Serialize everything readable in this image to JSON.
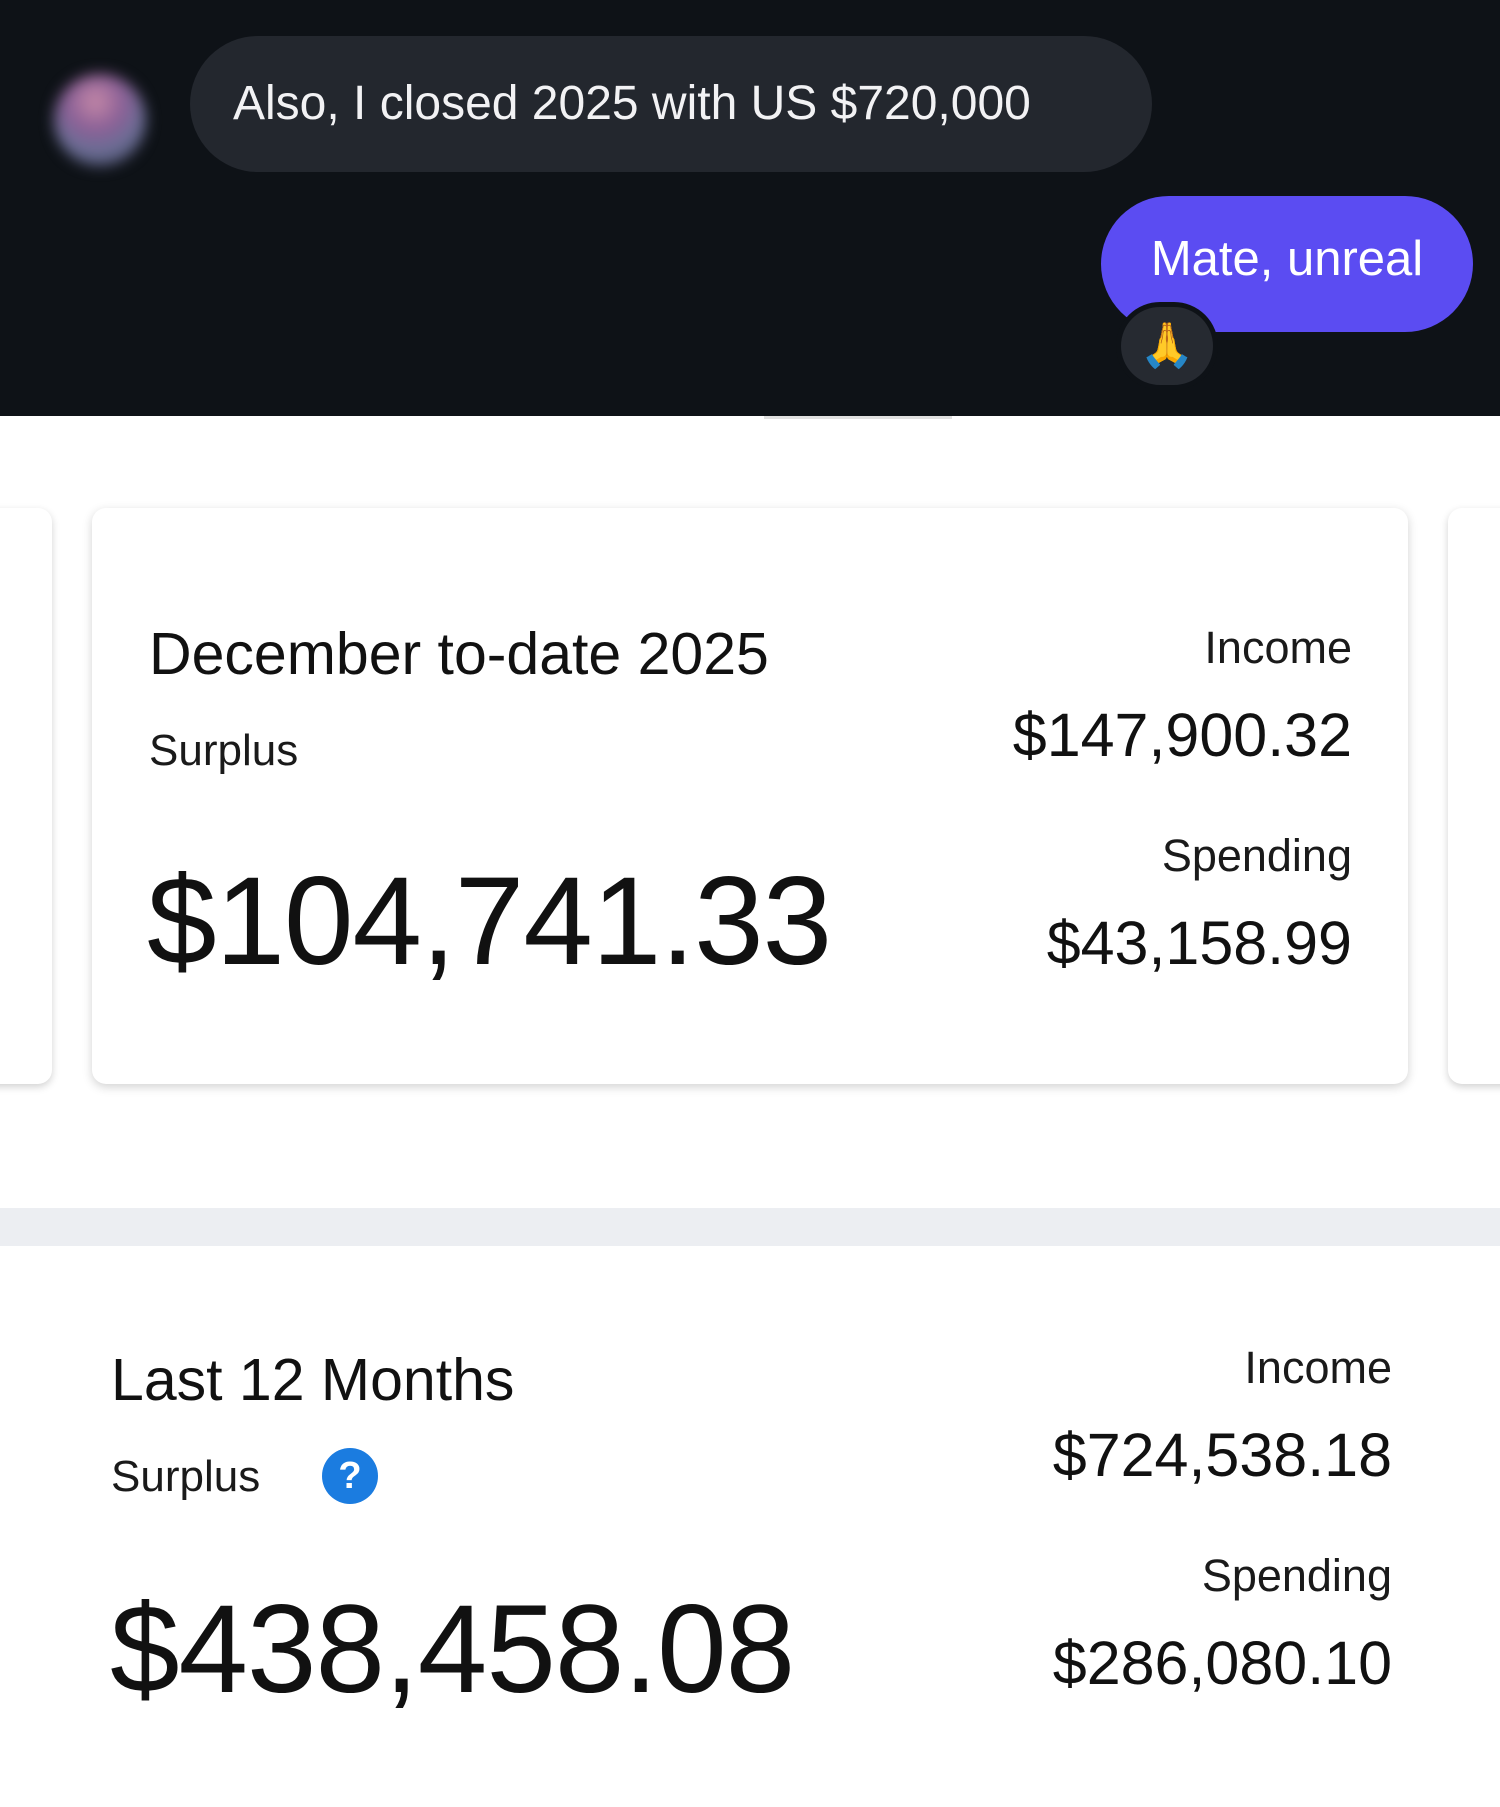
{
  "chat": {
    "incoming_message": "Also, I closed 2025 with US $720,000",
    "outgoing_message": "Mate, unreal",
    "reaction": "🙏"
  },
  "december_card": {
    "title": "December to-date 2025",
    "surplus_label": "Surplus",
    "surplus_value": "$104,741.33",
    "income_label": "Income",
    "income_value": "$147,900.32",
    "spending_label": "Spending",
    "spending_value": "$43,158.99"
  },
  "last12_section": {
    "title": "Last 12 Months",
    "surplus_label": "Surplus",
    "help_icon": "question-circle-icon",
    "help_glyph": "?",
    "surplus_value": "$438,458.08",
    "income_label": "Income",
    "income_value": "$724,538.18",
    "spending_label": "Spending",
    "spending_value": "$286,080.10"
  },
  "colors": {
    "chat_background": "#0e1217",
    "incoming_bubble": "#23272e",
    "outgoing_bubble": "#5b4cf2",
    "help_icon": "#1b7ce0"
  }
}
